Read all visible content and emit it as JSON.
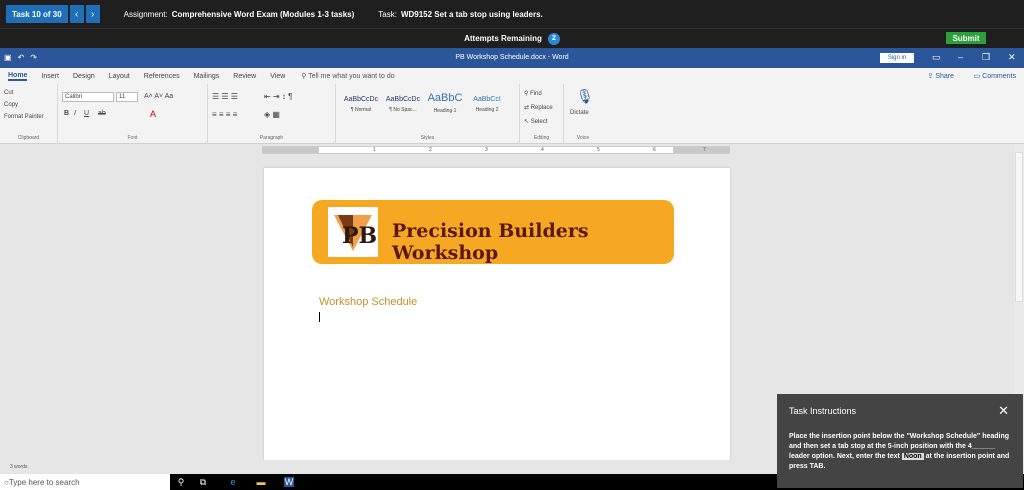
{
  "top": {
    "task_num": "Task 10 of 30",
    "assignment_label": "Assignment:",
    "assignment": "Comprehensive Word Exam (Modules 1-3 tasks)",
    "task_label": "Task:",
    "task": "WD9152 Set a tab stop using leaders."
  },
  "attempts": {
    "label": "Attempts Remaining",
    "count": "2"
  },
  "submit_label": "Submit",
  "titlebar": {
    "doc_title": "PB Workshop Schedule.docx - Word",
    "signin": "Sign in"
  },
  "menu": {
    "tabs": [
      "Home",
      "Insert",
      "Design",
      "Layout",
      "References",
      "Mailings",
      "Review",
      "View"
    ],
    "tellme": "Tell me what you want to do",
    "share": "Share",
    "comments": "Comments"
  },
  "ribbon": {
    "clipboard": {
      "cut": "Cut",
      "copy": "Copy",
      "format_painter": "Format Painter",
      "label": "Clipboard"
    },
    "font": {
      "name": "Calibri",
      "size": "11",
      "label": "Font"
    },
    "paragraph": {
      "label": "Paragraph"
    },
    "styles": {
      "items": [
        {
          "sample": "AaBbCcDc",
          "name": "¶ Normal"
        },
        {
          "sample": "AaBbCcDc",
          "name": "¶ No Spac..."
        },
        {
          "sample": "AaBbC",
          "name": "Heading 1"
        },
        {
          "sample": "AaBbCcI",
          "name": "Heading 2"
        }
      ],
      "label": "Styles"
    },
    "editing": {
      "find": "Find",
      "replace": "Replace",
      "select": "Select",
      "label": "Editing"
    },
    "voice": {
      "dictate": "Dictate",
      "label": "Voice"
    }
  },
  "ruler": {
    "nums": [
      "1",
      "2",
      "3",
      "4",
      "5",
      "6",
      "7"
    ]
  },
  "document": {
    "banner_title": "Precision Builders Workshop",
    "logo_text": "PB",
    "heading": "Workshop Schedule"
  },
  "status": {
    "words": "3 words"
  },
  "taskbar": {
    "search": "Type here to search"
  },
  "panel": {
    "title": "Task Instructions",
    "text_1": "Place the insertion point below the \"Workshop Schedule\" heading and then set a tab stop at the 5-inch position with the 4______ leader option. Next, enter the text",
    "kbd": "Noon",
    "text_2": "at the insertion point and press TAB."
  },
  "colors": {
    "title_blue": "#2b579a",
    "banner": "#f7a823",
    "heading": "#c5902c"
  }
}
